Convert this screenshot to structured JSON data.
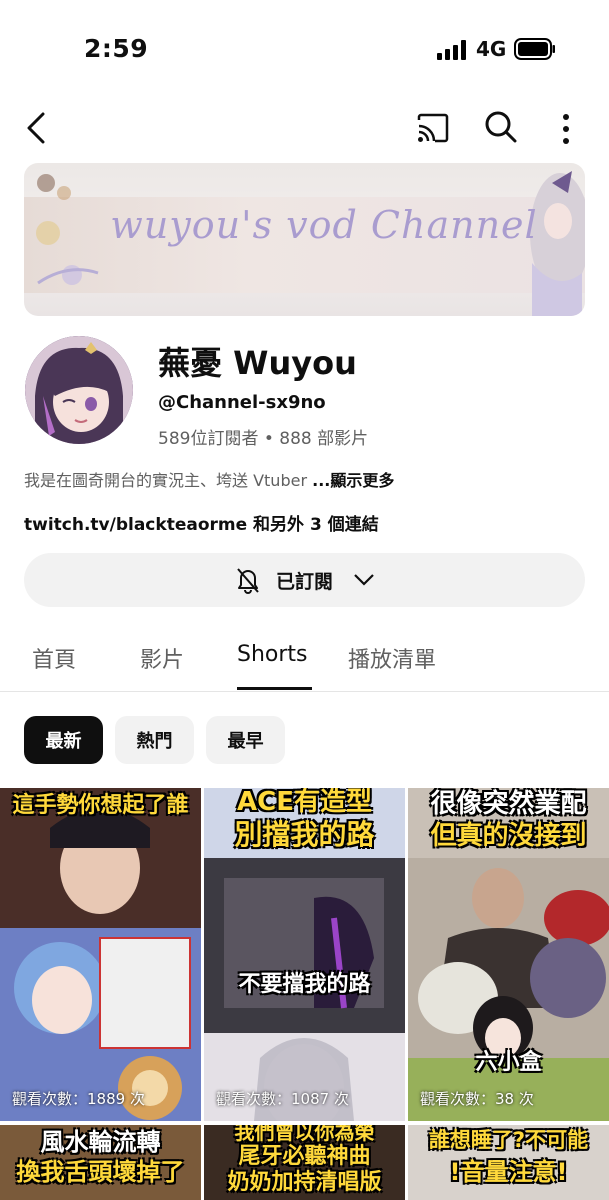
{
  "status_bar": {
    "time": "2:59",
    "network": "4G"
  },
  "channel": {
    "banner_text": "wuyou's vod Channel",
    "name": "蕪憂 Wuyou",
    "handle": "@Channel-sx9no",
    "stats": "589位訂閱者 • 888 部影片",
    "description": "我是在圖奇開台的實況主、垮送 Vtuber ",
    "show_more": "...顯示更多",
    "links": "twitch.tv/blackteaorme 和另外 3 個連結"
  },
  "subscribe": {
    "label": "已訂閱"
  },
  "tabs": [
    {
      "label": "首頁"
    },
    {
      "label": "影片"
    },
    {
      "label": "Shorts"
    },
    {
      "label": "播放清單"
    }
  ],
  "active_tab": "Shorts",
  "filters": [
    {
      "label": "最新"
    },
    {
      "label": "熱門"
    },
    {
      "label": "最早"
    }
  ],
  "shorts": [
    {
      "caption": "這手勢你想起了誰",
      "views": "觀看次數：1889 次"
    },
    {
      "caption_1": "ACE有造型",
      "caption_2": "別擋我的路",
      "sub": "不要擋我的路",
      "views": "觀看次數：1087 次"
    },
    {
      "caption_1": "很像突然業配",
      "caption_2": "但真的沒接到",
      "sub": "六小盒",
      "views": "觀看次數：38 次"
    },
    {
      "caption_1": "風水輪流轉",
      "caption_2": "換我舌頭壞掉了"
    },
    {
      "caption_1": "我們曾以你為榮",
      "caption_2": "尾牙必聽神曲",
      "caption_3": "奶奶加持清唱版"
    },
    {
      "caption_1": "誰想睡了?不可能",
      "caption_2": "!音量注意!"
    }
  ],
  "colors": {
    "banner_title": "#a99ccf",
    "chip_active": "#0f0f0f",
    "chip": "#f2f2f2",
    "caption_yellow": "#ffd93b"
  }
}
